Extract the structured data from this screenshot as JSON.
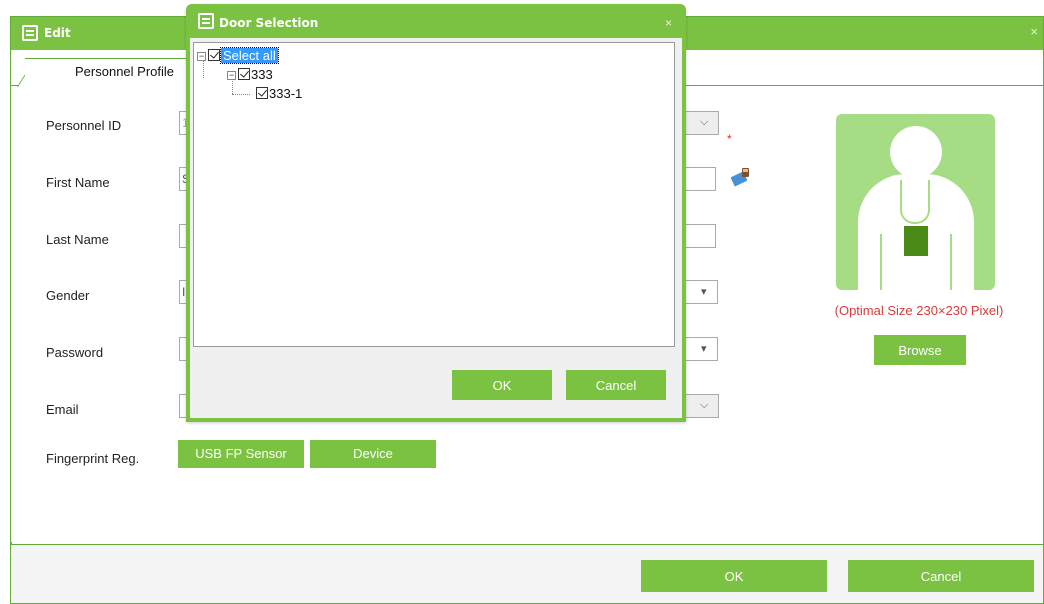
{
  "edit_window": {
    "title": "Edit",
    "close": "×",
    "tab_label": "Personnel Profile",
    "fields": {
      "personnel_id_label": "Personnel ID",
      "personnel_id_value": "1",
      "required_marker": "*",
      "first_name_label": "First Name",
      "first_name_value": "S",
      "last_name_label": "Last Name",
      "gender_label": "Gender",
      "gender_value": "I",
      "password_label": "Password",
      "email_label": "Email",
      "fingerprint_label": "Fingerprint Reg."
    },
    "buttons": {
      "usb_fp_sensor": "USB FP Sensor",
      "device": "Device",
      "browse": "Browse",
      "ok": "OK",
      "cancel": "Cancel"
    },
    "photo_hint": "(Optimal Size 230×230 Pixel)"
  },
  "door_selection": {
    "title": "Door Selection",
    "close": "×",
    "tree": {
      "root_label": "Select all",
      "child_label": "333",
      "leaf_label": "333-1"
    },
    "ok": "OK",
    "cancel": "Cancel"
  }
}
